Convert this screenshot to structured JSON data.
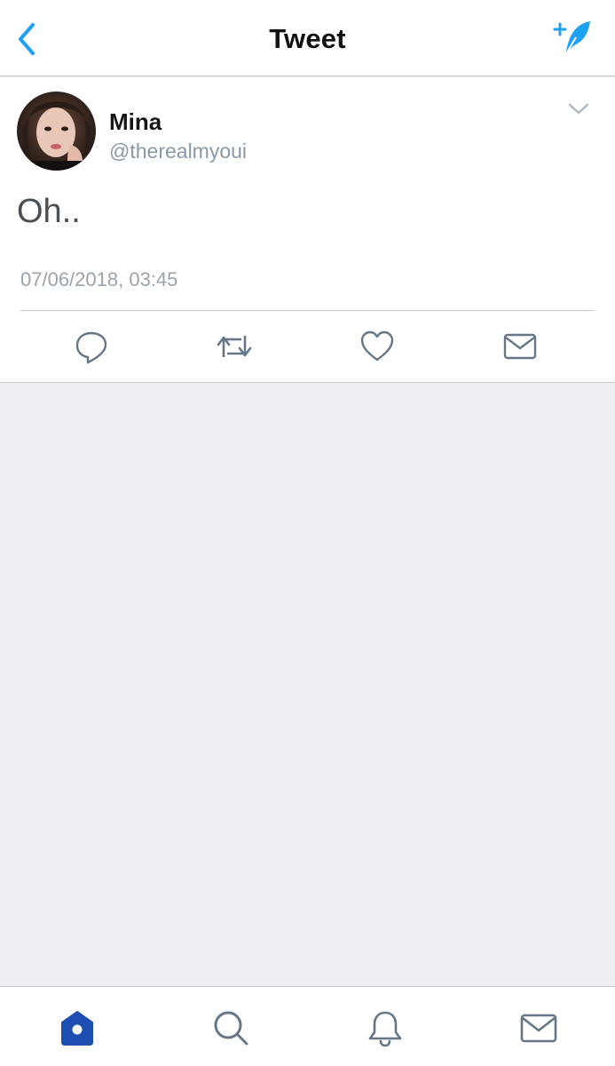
{
  "header": {
    "title": "Tweet",
    "back_icon": "chevron-left-icon",
    "compose_icon": "compose-feather-icon"
  },
  "tweet": {
    "author_name": "Mina",
    "author_handle": "@therealmyoui",
    "text": "Oh..",
    "timestamp": "07/06/2018, 03:45",
    "actions": [
      "reply-icon",
      "retweet-icon",
      "like-icon",
      "direct-message-icon"
    ]
  },
  "tabbar": {
    "items": [
      "home-icon",
      "search-icon",
      "notifications-icon",
      "messages-icon"
    ],
    "active": "home"
  },
  "colors": {
    "accent": "#1da1f2",
    "active_tab": "#1c4fb0",
    "icon_gray": "#657786",
    "secondary_text": "#8899a6",
    "background": "#ededf2"
  }
}
